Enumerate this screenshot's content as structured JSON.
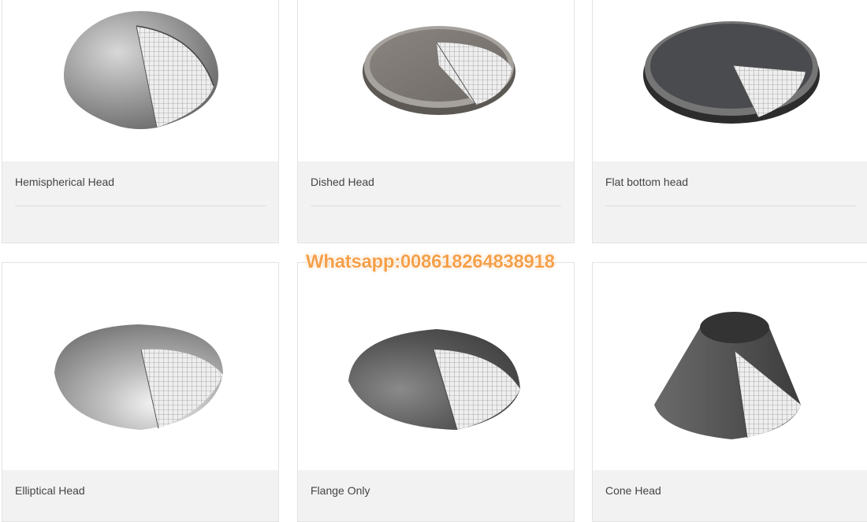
{
  "products": [
    {
      "title": "Hemispherical Head",
      "icon": "hemispherical-head-image"
    },
    {
      "title": "Dished Head",
      "icon": "dished-head-image"
    },
    {
      "title": "Flat bottom head",
      "icon": "flat-bottom-head-image"
    },
    {
      "title": "Elliptical Head",
      "icon": "elliptical-head-image"
    },
    {
      "title": "Flange Only",
      "icon": "flange-only-image"
    },
    {
      "title": "Cone Head",
      "icon": "cone-head-image"
    }
  ],
  "watermark": "Whatsapp:008618264838918",
  "colors": {
    "caption_bg": "#f2f2f2",
    "caption_text": "#444444",
    "watermark": "#f5a04a"
  }
}
